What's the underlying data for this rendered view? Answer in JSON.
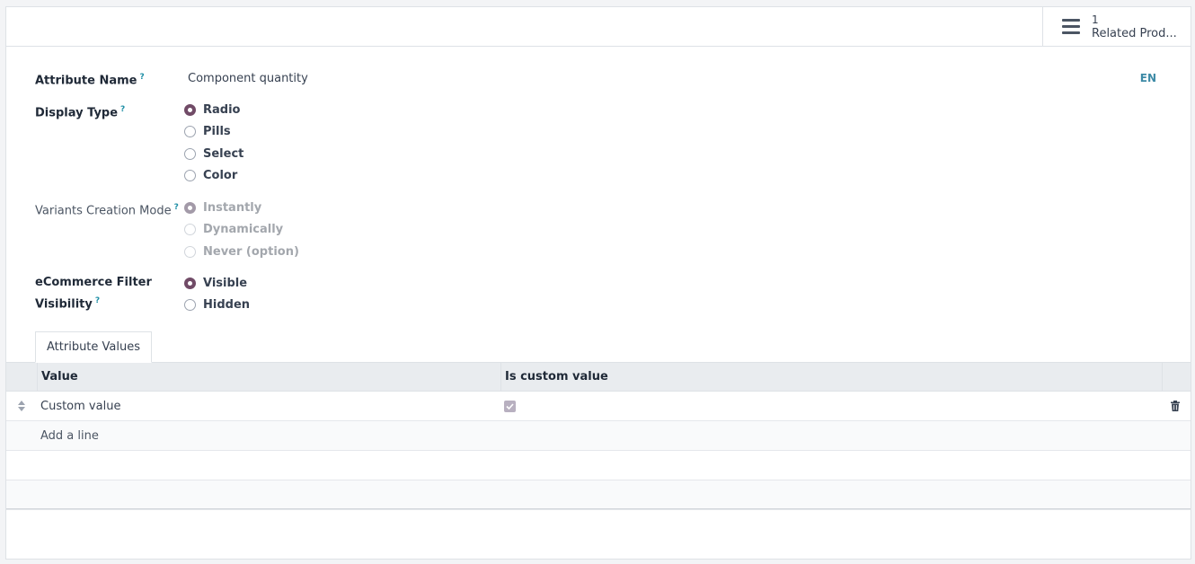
{
  "stat_button": {
    "count": "1",
    "label": "Related Prod..."
  },
  "form": {
    "attribute_name": {
      "label": "Attribute Name",
      "help": "?",
      "value": "Component quantity",
      "lang": "EN"
    },
    "display_type": {
      "label": "Display Type",
      "help": "?",
      "options": [
        "Radio",
        "Pills",
        "Select",
        "Color"
      ],
      "selected": "Radio"
    },
    "variants_creation_mode": {
      "label": "Variants Creation Mode",
      "help": "?",
      "options": [
        "Instantly",
        "Dynamically",
        "Never (option)"
      ],
      "selected": "Instantly",
      "disabled": true
    },
    "ecommerce_filter_visibility": {
      "label_line1": "eCommerce Filter",
      "label_line2": "Visibility",
      "help": "?",
      "options": [
        "Visible",
        "Hidden"
      ],
      "selected": "Visible"
    }
  },
  "tabs": [
    {
      "label": "Attribute Values",
      "active": true
    }
  ],
  "table": {
    "columns": [
      "Value",
      "Is custom value"
    ],
    "rows": [
      {
        "value": "Custom value",
        "is_custom": true
      }
    ],
    "add_line": "Add a line"
  },
  "colors": {
    "primary": "#714b67",
    "link": "#3d8aa6",
    "header_bg": "#e9ecef"
  }
}
